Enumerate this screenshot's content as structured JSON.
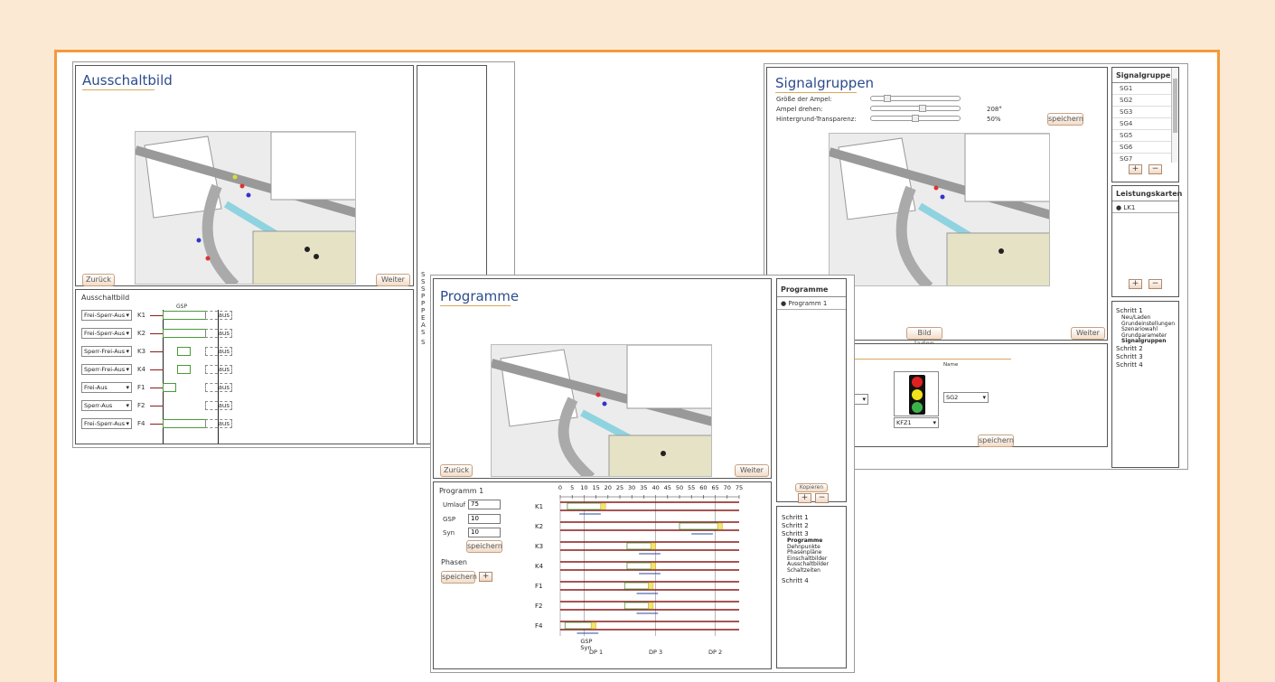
{
  "ausschaltbild": {
    "title": "Ausschaltbild",
    "back_label": "Zurück",
    "next_label": "Weiter",
    "table_title": "Ausschaltbild",
    "gsp_label": "GSP",
    "rows": [
      {
        "mode": "Frei-Sperr-Aus",
        "group": "K1",
        "aus": "aus"
      },
      {
        "mode": "Frei-Sperr-Aus",
        "group": "K2",
        "aus": "aus"
      },
      {
        "mode": "Sperr-Frei-Aus",
        "group": "K3",
        "aus": "aus"
      },
      {
        "mode": "Sperr-Frei-Aus",
        "group": "K4",
        "aus": "aus"
      },
      {
        "mode": "Frei-Aus",
        "group": "F1",
        "aus": "aus"
      },
      {
        "mode": "Sperr-Aus",
        "group": "F2",
        "aus": "aus"
      },
      {
        "mode": "Frei-Sperr-Aus",
        "group": "F4",
        "aus": "aus"
      }
    ],
    "side_letters": [
      "S",
      "S",
      "S",
      "P",
      "P",
      "P",
      "E",
      "A",
      "S",
      "S"
    ]
  },
  "signalgruppen": {
    "title": "Signalgruppen",
    "size_label": "Größe der Ampel:",
    "rotate_label": "Ampel drehen:",
    "rotate_value": "208°",
    "transparency_label": "Hintergrund-Transparenz:",
    "transparency_value": "50%",
    "save_label": "speichern",
    "load_image_label": "Bild laden",
    "next_label": "Weiter",
    "signal_list_title": "Signalgruppe",
    "signal_groups": [
      "SG1",
      "SG2",
      "SG3",
      "SG4",
      "SG5",
      "SG6",
      "SG7"
    ],
    "cards_title": "Leistungskarten",
    "cards": [
      "LK1"
    ],
    "editor_name_label": "Name",
    "editor_sg_value": "SG2",
    "editor_type_value": "KFZ1",
    "editor_save_label": "speichern",
    "steps": [
      {
        "label": "Schritt 1",
        "sub": [
          {
            "label": "Neu/Laden",
            "bold": false
          },
          {
            "label": "Grundeinstellungen",
            "bold": false
          },
          {
            "label": "Szenariowahl",
            "bold": false
          },
          {
            "label": "Grundparameter",
            "bold": false
          },
          {
            "label": "Signalgruppen",
            "bold": true
          }
        ]
      },
      {
        "label": "Schritt 2",
        "sub": []
      },
      {
        "label": "Schritt 3",
        "sub": []
      },
      {
        "label": "Schritt 4",
        "sub": []
      }
    ]
  },
  "programme": {
    "title": "Programme",
    "back_label": "Zurück",
    "next_label": "Weiter",
    "list_title": "Programme",
    "programs": [
      "Programm 1"
    ],
    "copy_label": "Kopieren",
    "prog_title": "Programm 1",
    "umlauf_label": "Umlauf",
    "umlauf_value": "75",
    "gsp_label": "GSP",
    "gsp_value": "10",
    "syn_label": "Syn",
    "syn_value": "10",
    "save_label": "speichern",
    "phasen_label": "Phasen",
    "phasen_save_label": "speichern",
    "axis_ticks": [
      "0",
      "5",
      "10",
      "15",
      "20",
      "25",
      "30",
      "35",
      "40",
      "45",
      "50",
      "55",
      "60",
      "65",
      "70",
      "75"
    ],
    "groups": [
      "K1",
      "K2",
      "K3",
      "K4",
      "F1",
      "F2",
      "F4"
    ],
    "bottom_gsp": "GSP",
    "bottom_syn": "Syn",
    "dp_labels": [
      "DP 1",
      "DP 3",
      "DP 2"
    ],
    "steps": [
      {
        "label": "Schritt 1",
        "sub": []
      },
      {
        "label": "Schritt 2",
        "sub": []
      },
      {
        "label": "Schritt 3",
        "sub": [
          {
            "label": "Programme",
            "bold": true
          },
          {
            "label": "Dehnpunkte",
            "bold": false
          },
          {
            "label": "Phasenpläne",
            "bold": false
          },
          {
            "label": "Einschaltbilder",
            "bold": false
          },
          {
            "label": "Ausschaltbilder",
            "bold": false
          },
          {
            "label": "Schaltzeiten",
            "bold": false
          }
        ]
      },
      {
        "label": "Schritt 4",
        "sub": []
      }
    ]
  },
  "colors": {
    "accent": "#f39a3a",
    "background": "#fce9d3",
    "title_blue": "#2b4c8c",
    "green_phase": "#4a9a3a",
    "red_phase": "#8b1a1a"
  }
}
